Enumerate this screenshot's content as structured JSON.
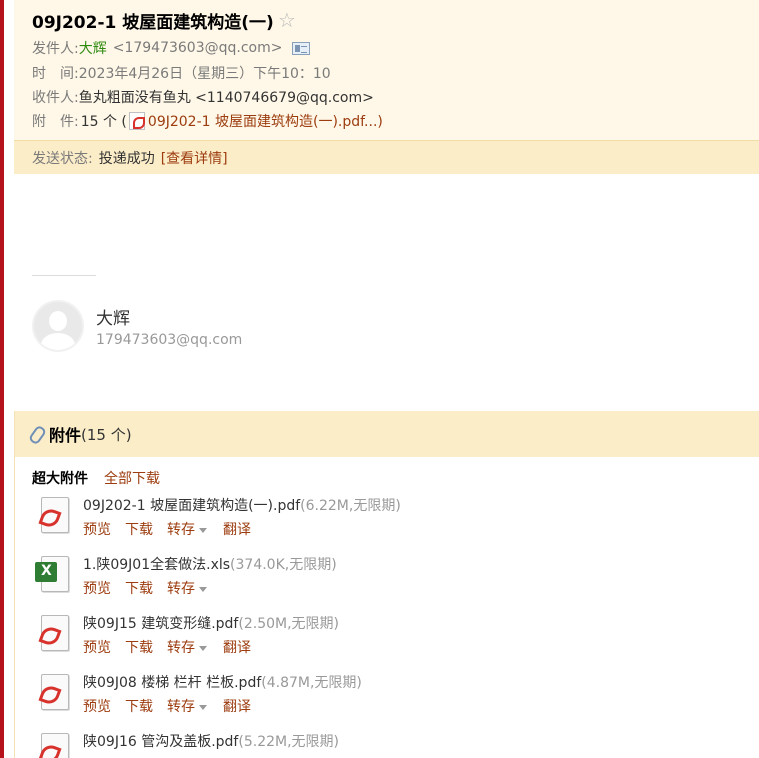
{
  "email": {
    "subject": "09J202-1 坡屋面建筑构造(一)",
    "from_label": "发件人:",
    "from_name": "大辉",
    "from_email": "<179473603@qq.com>",
    "time_label": "时　间:",
    "time_value": "2023年4月26日（星期三）下午10：10",
    "to_label": "收件人:",
    "to_value": "鱼丸粗面没有鱼丸 <1140746679@qq.com>",
    "attach_label": "附　件:",
    "attach_count": "15 个 (",
    "attach_first": "09J202-1 坡屋面建筑构造(一).pdf...)",
    "status_label": "发送状态:",
    "status_value": "投递成功",
    "status_link": "[查看详情]"
  },
  "signature": {
    "name": "大辉",
    "email": "179473603@qq.com"
  },
  "attachments": {
    "title": "附件",
    "count": "(15 个)",
    "section_label": "超大附件",
    "download_all": "全部下载",
    "actions": {
      "preview": "预览",
      "download": "下载",
      "transfer": "转存",
      "translate": "翻译"
    },
    "files": [
      {
        "name": "09J202-1 坡屋面建筑构造(一).pdf",
        "meta": "(6.22M,无限期)",
        "type": "pdf"
      },
      {
        "name": "1.陕09J01全套做法.xls",
        "meta": "(374.0K,无限期)",
        "type": "xls"
      },
      {
        "name": "陕09J15 建筑变形缝.pdf",
        "meta": "(2.50M,无限期)",
        "type": "pdf"
      },
      {
        "name": "陕09J08 楼梯 栏杆 栏板.pdf",
        "meta": "(4.87M,无限期)",
        "type": "pdf"
      },
      {
        "name": "陕09J16 管沟及盖板.pdf",
        "meta": "(5.22M,无限期)",
        "type": "pdf"
      }
    ]
  },
  "colors": {
    "header_bg": "#fff8e8",
    "status_bg": "#fcedc9",
    "link": "#9c3c0f",
    "sender": "#2f8a11"
  },
  "icons": [
    "star-icon",
    "contact-card-icon",
    "pdf-icon",
    "paperclip-icon",
    "xls-icon",
    "avatar-icon",
    "caret-down-icon"
  ]
}
